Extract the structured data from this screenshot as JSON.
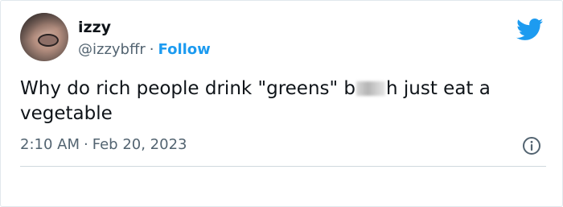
{
  "tweet": {
    "author_name": "izzy",
    "handle": "@izzybffr",
    "separator": "·",
    "follow_label": "Follow",
    "text_before": "Why do rich people drink \"greens\" b",
    "text_after": "h just eat a vegetable",
    "time": "2:10 AM",
    "date": "Feb 20, 2023"
  },
  "icons": {
    "brand": "twitter-bird-icon",
    "info": "info-icon"
  },
  "colors": {
    "accent": "#1d9bf0",
    "text": "#0f1419",
    "muted": "#536471",
    "divider": "#cfd9de"
  }
}
